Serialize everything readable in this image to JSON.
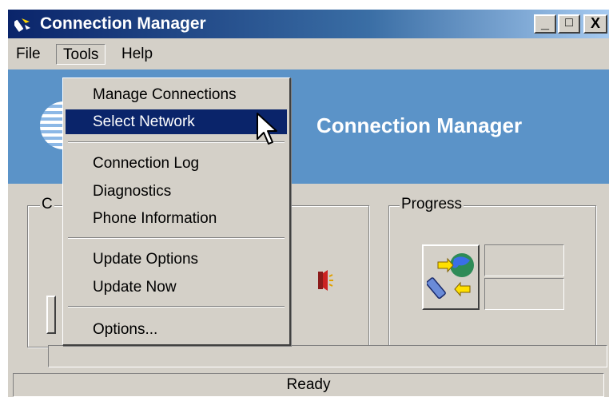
{
  "window": {
    "title": "Connection Manager",
    "icon": "phone-app-icon"
  },
  "title_buttons": {
    "minimize": "_",
    "maximize": "□",
    "close": "X"
  },
  "menubar": {
    "items": [
      {
        "label": "File"
      },
      {
        "label": "Tools"
      },
      {
        "label": "Help"
      }
    ],
    "open_menu": "Tools"
  },
  "banner": {
    "title": "Connection Manager"
  },
  "left_group": {
    "label": "C"
  },
  "progress_group": {
    "label": "Progress"
  },
  "tools_menu": {
    "items": [
      {
        "label": "Manage Connections"
      },
      {
        "label": "Select Network",
        "highlighted": true
      },
      {
        "label": "Connection Log"
      },
      {
        "label": "Diagnostics"
      },
      {
        "label": "Phone Information"
      },
      {
        "label": "Update Options"
      },
      {
        "label": "Update Now"
      },
      {
        "label": "Options..."
      }
    ]
  },
  "status": {
    "text": "Ready"
  },
  "colors": {
    "title_start": "#0a246a",
    "title_end": "#a6caf0",
    "banner": "#5b93c8",
    "highlight": "#0a246a",
    "face": "#d4d0c8"
  }
}
